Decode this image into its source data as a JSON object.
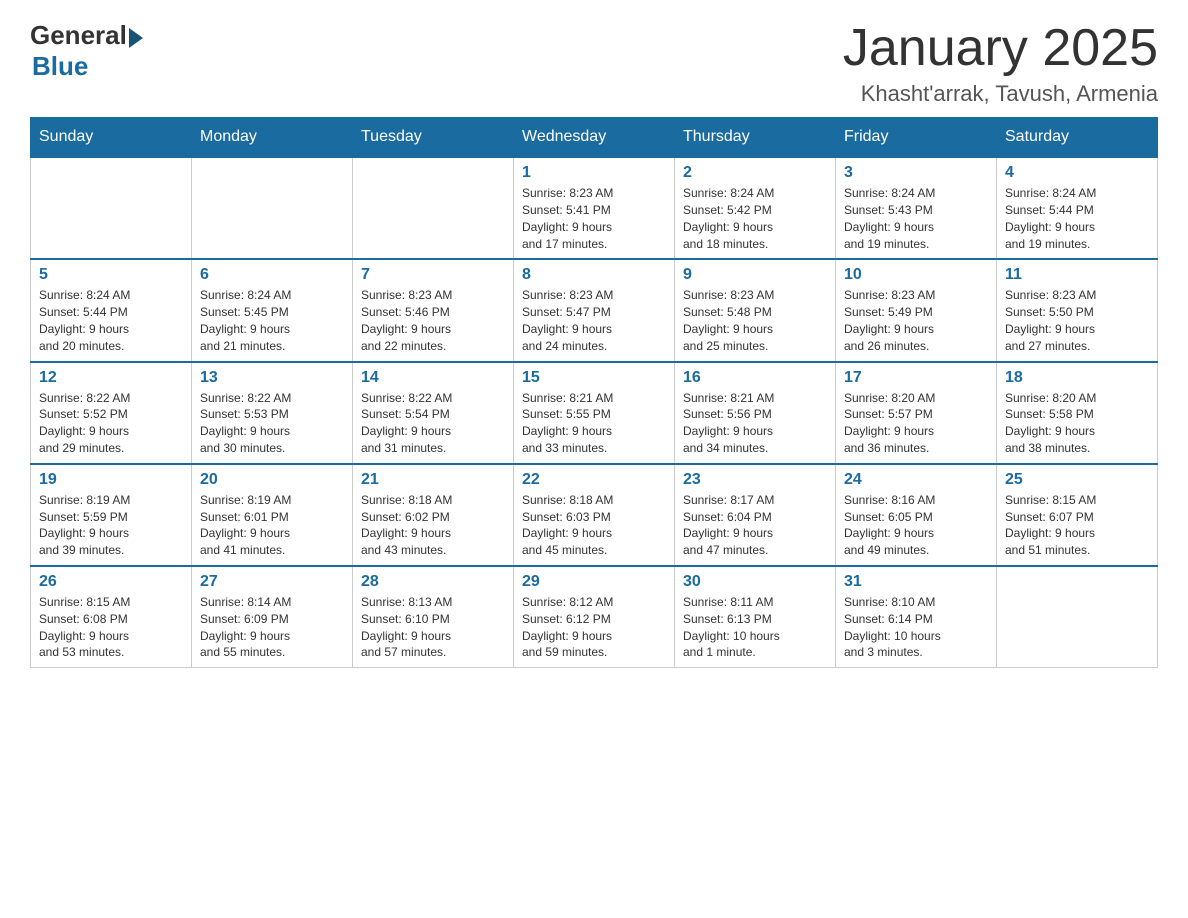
{
  "header": {
    "logo": {
      "general": "General",
      "blue": "Blue"
    },
    "title": "January 2025",
    "location": "Khasht'arrak, Tavush, Armenia"
  },
  "calendar": {
    "days_of_week": [
      "Sunday",
      "Monday",
      "Tuesday",
      "Wednesday",
      "Thursday",
      "Friday",
      "Saturday"
    ],
    "weeks": [
      [
        {
          "day": "",
          "info": ""
        },
        {
          "day": "",
          "info": ""
        },
        {
          "day": "",
          "info": ""
        },
        {
          "day": "1",
          "info": "Sunrise: 8:23 AM\nSunset: 5:41 PM\nDaylight: 9 hours\nand 17 minutes."
        },
        {
          "day": "2",
          "info": "Sunrise: 8:24 AM\nSunset: 5:42 PM\nDaylight: 9 hours\nand 18 minutes."
        },
        {
          "day": "3",
          "info": "Sunrise: 8:24 AM\nSunset: 5:43 PM\nDaylight: 9 hours\nand 19 minutes."
        },
        {
          "day": "4",
          "info": "Sunrise: 8:24 AM\nSunset: 5:44 PM\nDaylight: 9 hours\nand 19 minutes."
        }
      ],
      [
        {
          "day": "5",
          "info": "Sunrise: 8:24 AM\nSunset: 5:44 PM\nDaylight: 9 hours\nand 20 minutes."
        },
        {
          "day": "6",
          "info": "Sunrise: 8:24 AM\nSunset: 5:45 PM\nDaylight: 9 hours\nand 21 minutes."
        },
        {
          "day": "7",
          "info": "Sunrise: 8:23 AM\nSunset: 5:46 PM\nDaylight: 9 hours\nand 22 minutes."
        },
        {
          "day": "8",
          "info": "Sunrise: 8:23 AM\nSunset: 5:47 PM\nDaylight: 9 hours\nand 24 minutes."
        },
        {
          "day": "9",
          "info": "Sunrise: 8:23 AM\nSunset: 5:48 PM\nDaylight: 9 hours\nand 25 minutes."
        },
        {
          "day": "10",
          "info": "Sunrise: 8:23 AM\nSunset: 5:49 PM\nDaylight: 9 hours\nand 26 minutes."
        },
        {
          "day": "11",
          "info": "Sunrise: 8:23 AM\nSunset: 5:50 PM\nDaylight: 9 hours\nand 27 minutes."
        }
      ],
      [
        {
          "day": "12",
          "info": "Sunrise: 8:22 AM\nSunset: 5:52 PM\nDaylight: 9 hours\nand 29 minutes."
        },
        {
          "day": "13",
          "info": "Sunrise: 8:22 AM\nSunset: 5:53 PM\nDaylight: 9 hours\nand 30 minutes."
        },
        {
          "day": "14",
          "info": "Sunrise: 8:22 AM\nSunset: 5:54 PM\nDaylight: 9 hours\nand 31 minutes."
        },
        {
          "day": "15",
          "info": "Sunrise: 8:21 AM\nSunset: 5:55 PM\nDaylight: 9 hours\nand 33 minutes."
        },
        {
          "day": "16",
          "info": "Sunrise: 8:21 AM\nSunset: 5:56 PM\nDaylight: 9 hours\nand 34 minutes."
        },
        {
          "day": "17",
          "info": "Sunrise: 8:20 AM\nSunset: 5:57 PM\nDaylight: 9 hours\nand 36 minutes."
        },
        {
          "day": "18",
          "info": "Sunrise: 8:20 AM\nSunset: 5:58 PM\nDaylight: 9 hours\nand 38 minutes."
        }
      ],
      [
        {
          "day": "19",
          "info": "Sunrise: 8:19 AM\nSunset: 5:59 PM\nDaylight: 9 hours\nand 39 minutes."
        },
        {
          "day": "20",
          "info": "Sunrise: 8:19 AM\nSunset: 6:01 PM\nDaylight: 9 hours\nand 41 minutes."
        },
        {
          "day": "21",
          "info": "Sunrise: 8:18 AM\nSunset: 6:02 PM\nDaylight: 9 hours\nand 43 minutes."
        },
        {
          "day": "22",
          "info": "Sunrise: 8:18 AM\nSunset: 6:03 PM\nDaylight: 9 hours\nand 45 minutes."
        },
        {
          "day": "23",
          "info": "Sunrise: 8:17 AM\nSunset: 6:04 PM\nDaylight: 9 hours\nand 47 minutes."
        },
        {
          "day": "24",
          "info": "Sunrise: 8:16 AM\nSunset: 6:05 PM\nDaylight: 9 hours\nand 49 minutes."
        },
        {
          "day": "25",
          "info": "Sunrise: 8:15 AM\nSunset: 6:07 PM\nDaylight: 9 hours\nand 51 minutes."
        }
      ],
      [
        {
          "day": "26",
          "info": "Sunrise: 8:15 AM\nSunset: 6:08 PM\nDaylight: 9 hours\nand 53 minutes."
        },
        {
          "day": "27",
          "info": "Sunrise: 8:14 AM\nSunset: 6:09 PM\nDaylight: 9 hours\nand 55 minutes."
        },
        {
          "day": "28",
          "info": "Sunrise: 8:13 AM\nSunset: 6:10 PM\nDaylight: 9 hours\nand 57 minutes."
        },
        {
          "day": "29",
          "info": "Sunrise: 8:12 AM\nSunset: 6:12 PM\nDaylight: 9 hours\nand 59 minutes."
        },
        {
          "day": "30",
          "info": "Sunrise: 8:11 AM\nSunset: 6:13 PM\nDaylight: 10 hours\nand 1 minute."
        },
        {
          "day": "31",
          "info": "Sunrise: 8:10 AM\nSunset: 6:14 PM\nDaylight: 10 hours\nand 3 minutes."
        },
        {
          "day": "",
          "info": ""
        }
      ]
    ]
  }
}
